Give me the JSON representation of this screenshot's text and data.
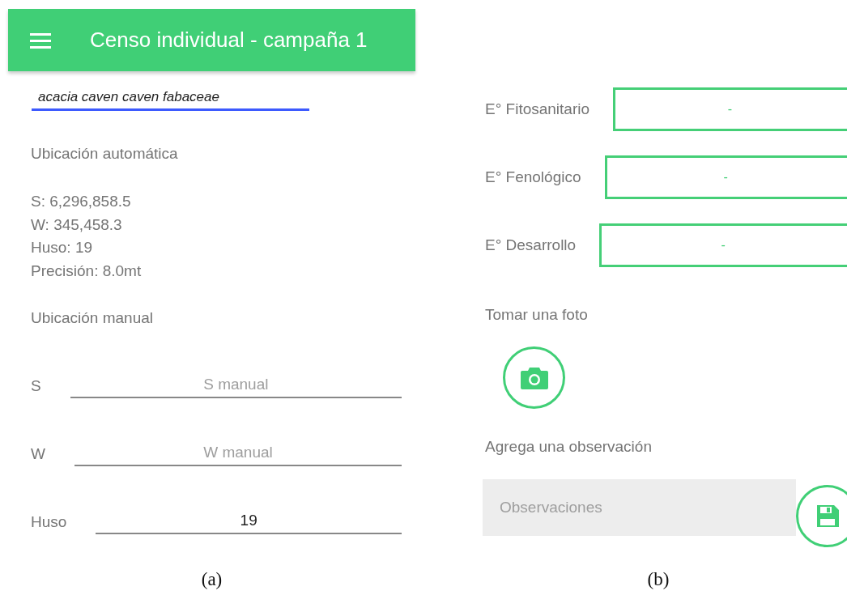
{
  "panel_a": {
    "caption": "(a)",
    "app_bar": {
      "title": "Censo individual - campaña 1"
    },
    "species_field": {
      "value": "acacia caven caven fabaceae"
    },
    "auto_location": {
      "heading": "Ubicación automática",
      "lines": [
        "S: 6,296,858.5",
        "W: 345,458.3",
        "Huso: 19",
        "Precisión: 8.0mt"
      ]
    },
    "manual_location": {
      "heading": "Ubicación manual",
      "fields": [
        {
          "label": "S",
          "placeholder": "S manual"
        },
        {
          "label": "W",
          "placeholder": "W manual"
        },
        {
          "label": "Huso",
          "value": "19"
        }
      ]
    }
  },
  "panel_b": {
    "caption": "(b)",
    "selects": [
      {
        "label": "E° Fitosanitario",
        "value": "-"
      },
      {
        "label": "E° Fenológico",
        "value": "-"
      },
      {
        "label": "E° Desarrollo",
        "value": "-"
      }
    ],
    "photo": {
      "heading": "Tomar una foto"
    },
    "observation": {
      "heading": "Agrega una observación",
      "placeholder": "Observaciones"
    }
  }
}
